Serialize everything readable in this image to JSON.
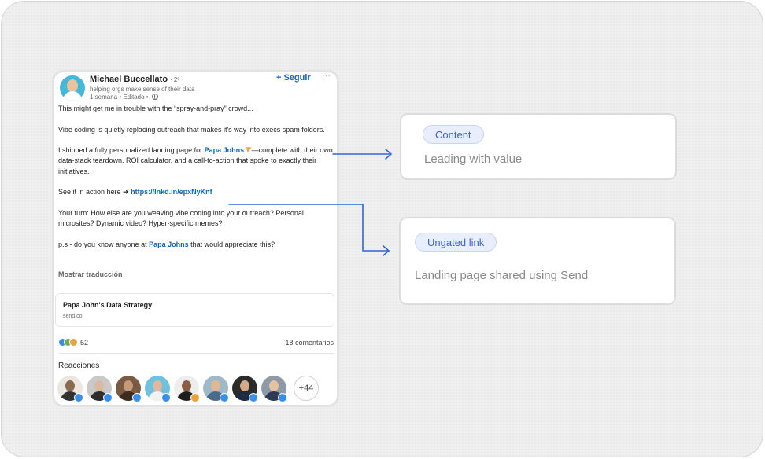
{
  "post": {
    "author_name": "Michael Buccellato",
    "author_degree": "· 2º",
    "author_headline": "helping orgs make sense of their data",
    "author_meta": "1 semana • Editado •",
    "follow_label": "+ Seguir",
    "more_label": "···",
    "line1": "This might get me in trouble with the “spray-and-pray” crowd...",
    "line2": "Vibe coding is quietly replacing outreach that makes it's way into execs spam folders.",
    "line3_before": "I shipped a fully personalized landing page for ",
    "line3_mention": "Papa Johns",
    "line3_after": "—complete with their own data-stack teardown, ROI calculator, and a call-to-action that spoke to exactly their initiatives.",
    "line4_before": "See it in action here ➜ ",
    "line4_link": "https://lnkd.in/epxNyKnf",
    "line5": "Your turn: How else are you weaving vibe coding into your outreach? Personal microsites? Dynamic video? Hyper-specific memes?",
    "line6_before": "p.s - do you know anyone at ",
    "line6_mention": "Papa Johns",
    "line6_after": " that would appreciate this?",
    "show_translation": "Mostrar traducción",
    "preview_title": "Papa John's Data Strategy",
    "preview_domain": "send.co",
    "reaction_count": "52",
    "comments_count": "18 comentarios",
    "reactions_title": "Reacciones",
    "more_reactors": "+44"
  },
  "annotations": [
    {
      "tag": "Content",
      "text": "Leading with value"
    },
    {
      "tag": "Ungated link",
      "text": "Landing page shared using Send"
    }
  ],
  "colors": {
    "linkedin_blue": "#0a66c2",
    "connector_blue": "#2f66d6",
    "tag_text": "#3d63d1",
    "tag_bg": "#e8eefc"
  }
}
